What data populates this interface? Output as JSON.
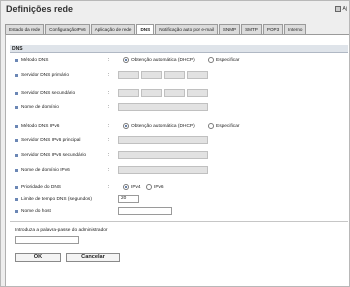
{
  "page": {
    "title": "Definições rede",
    "help_label": "Aj"
  },
  "tabs": [
    {
      "label": "Estado da rede"
    },
    {
      "label": "ConfiguraçãoIPv6"
    },
    {
      "label": "Aplicação de rede"
    },
    {
      "label": "DNS",
      "active": true
    },
    {
      "label": "Notificação auto por e-mail"
    },
    {
      "label": "SNMP"
    },
    {
      "label": "SMTP"
    },
    {
      "label": "POP3"
    },
    {
      "label": "Interno"
    }
  ],
  "section": {
    "title": "DNS"
  },
  "fields": {
    "dns_method": {
      "label": "Método DNS",
      "options": [
        "Obtenção automática (DHCP)",
        "Especificar"
      ],
      "selected": "Obtenção automática (DHCP)"
    },
    "primary_dns": {
      "label": "Servidor DNS primário"
    },
    "secondary_dns": {
      "label": "Servidor DNS secundário"
    },
    "domain_name": {
      "label": "Nome de domínio"
    },
    "dns_method_ipv6": {
      "label": "Método DNS IPv6",
      "options": [
        "Obtenção automática (DHCP)",
        "Especificar"
      ],
      "selected": "Obtenção automática (DHCP)"
    },
    "primary_dns_ipv6": {
      "label": "Servidor DNS IPv6 principal"
    },
    "secondary_dns_ipv6": {
      "label": "Servidor DNS IPv6 secundário"
    },
    "domain_name_ipv6": {
      "label": "Nome de domínio IPv6"
    },
    "dns_priority": {
      "label": "Prioridade do DNS",
      "options": [
        "IPv4",
        "IPv6"
      ],
      "selected": "IPv4"
    },
    "timeout": {
      "label": "Limite de tempo DNS (segundos)",
      "value": "20"
    },
    "host_name": {
      "label": "Nome do host",
      "value": ""
    }
  },
  "admin": {
    "password_label": "Introduza a palavra-passe do administrador",
    "password_value": ""
  },
  "buttons": {
    "ok": "OK",
    "cancel": "Cancelar"
  },
  "colors": {
    "tab_active": "#ffffff",
    "section_header": "#dfe4ea",
    "bullet": "#6b87b5"
  }
}
